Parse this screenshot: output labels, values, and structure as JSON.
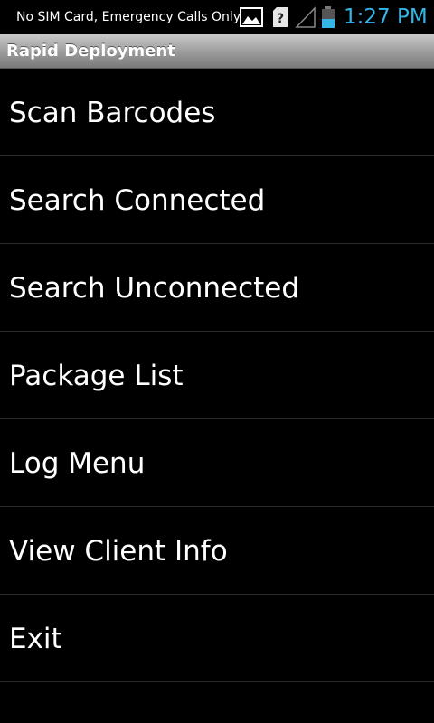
{
  "status_bar": {
    "carrier_text": "No SIM Card, Emergency Calls Only",
    "time": "1:27 PM",
    "icons": [
      "image-icon",
      "unknown-sim-icon",
      "signal-strength-icon",
      "battery-icon"
    ],
    "time_color": "#33b5e5"
  },
  "title_bar": {
    "title": "Rapid Deployment"
  },
  "menu": {
    "items": [
      {
        "label": "Scan Barcodes"
      },
      {
        "label": "Search Connected"
      },
      {
        "label": "Search Unconnected"
      },
      {
        "label": "Package List"
      },
      {
        "label": "Log Menu"
      },
      {
        "label": "View Client Info"
      },
      {
        "label": "Exit"
      }
    ]
  }
}
